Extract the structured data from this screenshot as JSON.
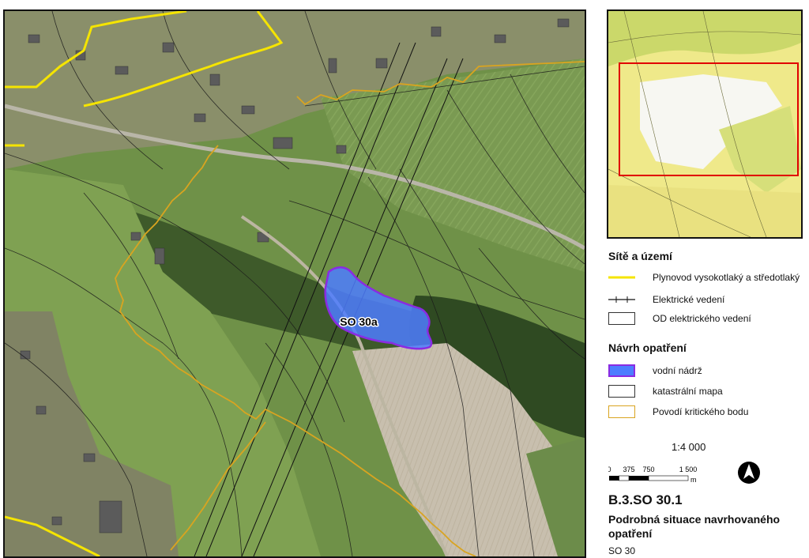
{
  "map": {
    "reservoir_label": "SO 30a"
  },
  "legend": {
    "section1_title": "Sítě a území",
    "section1_items": [
      {
        "label": "Plynovod vysokotlaký a středotlaký",
        "color": "#f5e400"
      },
      {
        "label": "Elektrické vedení",
        "color": "#111111"
      },
      {
        "label": "OD elektrického vedení",
        "color": "#333333"
      }
    ],
    "section2_title": "Návrh opatření",
    "section2_items": [
      {
        "label": "vodní nádrž",
        "color": "#4d7dff"
      },
      {
        "label": "katastrální mapa",
        "color": "#333333"
      },
      {
        "label": "Povodí kritického bodu",
        "color": "#d9a420"
      }
    ]
  },
  "scale": {
    "ratio": "1:4 000",
    "ticks": [
      "0",
      "375",
      "750",
      "1 500"
    ],
    "unit": "m"
  },
  "document": {
    "code": "B.3.SO 30.1",
    "title": "Podrobná situace navrhovaného opatření",
    "subtitle": "SO 30"
  },
  "colors": {
    "reservoir_fill": "#4d7dff",
    "reservoir_outline": "#8a2be2",
    "gas_line": "#f5e400",
    "catchment": "#d9a420",
    "overview_frame": "#e00000"
  }
}
